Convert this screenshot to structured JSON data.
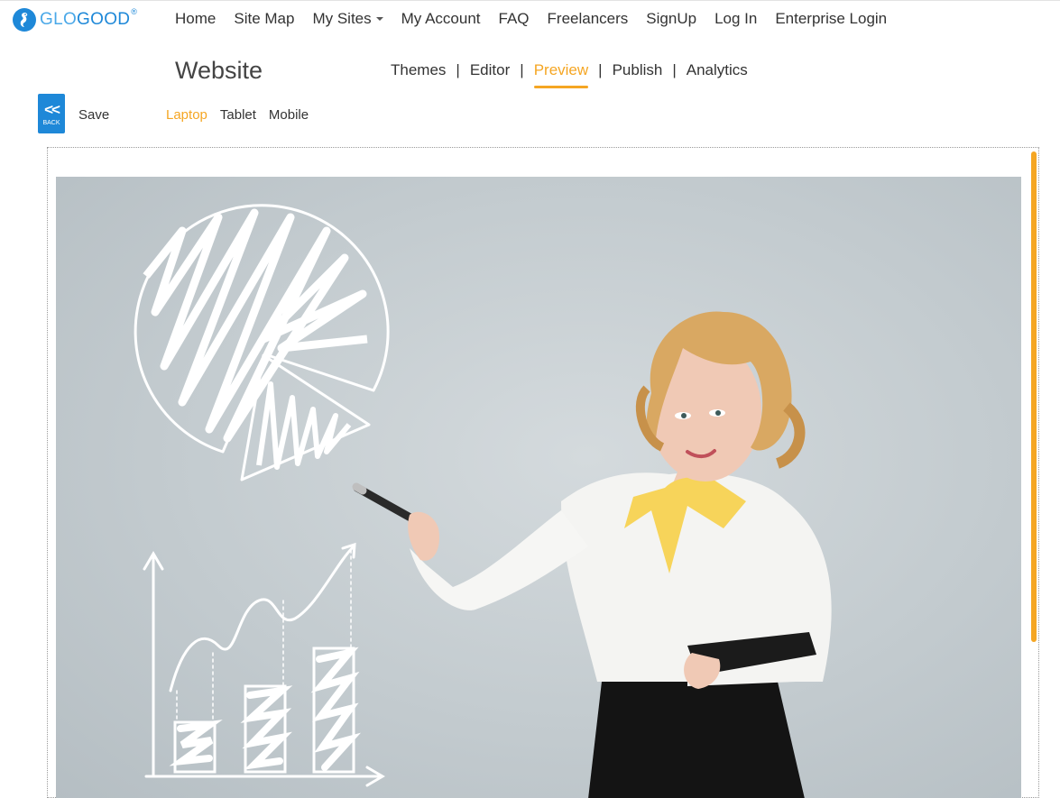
{
  "app": {
    "logo_text_glo": "GLO",
    "logo_text_good": "GOOD",
    "logo_reg": "®"
  },
  "nav": {
    "items": [
      {
        "label": "Home"
      },
      {
        "label": "Site Map"
      },
      {
        "label": "My Sites"
      },
      {
        "label": "My Account"
      },
      {
        "label": "FAQ"
      },
      {
        "label": "Freelancers"
      },
      {
        "label": "SignUp"
      },
      {
        "label": "Log In"
      },
      {
        "label": "Enterprise Login"
      }
    ]
  },
  "editor": {
    "site_title": "Website",
    "modes": [
      {
        "label": "Themes"
      },
      {
        "label": "Editor"
      },
      {
        "label": "Preview"
      },
      {
        "label": "Publish"
      },
      {
        "label": "Analytics"
      }
    ],
    "active_mode": "Preview",
    "separator": "|"
  },
  "toolbar": {
    "back_chevron": "<<",
    "back_label": "BACK",
    "save_label": "Save",
    "devices": [
      {
        "label": "Laptop"
      },
      {
        "label": "Tablet"
      },
      {
        "label": "Mobile"
      }
    ],
    "active_device": "Laptop"
  },
  "colors": {
    "brand_blue": "#1e88d8",
    "accent_orange": "#f5a623",
    "text": "#333333"
  },
  "icons": {
    "logo": "seahorse-logo-icon",
    "back": "double-chevron-left-icon",
    "dropdown": "caret-down-icon"
  }
}
